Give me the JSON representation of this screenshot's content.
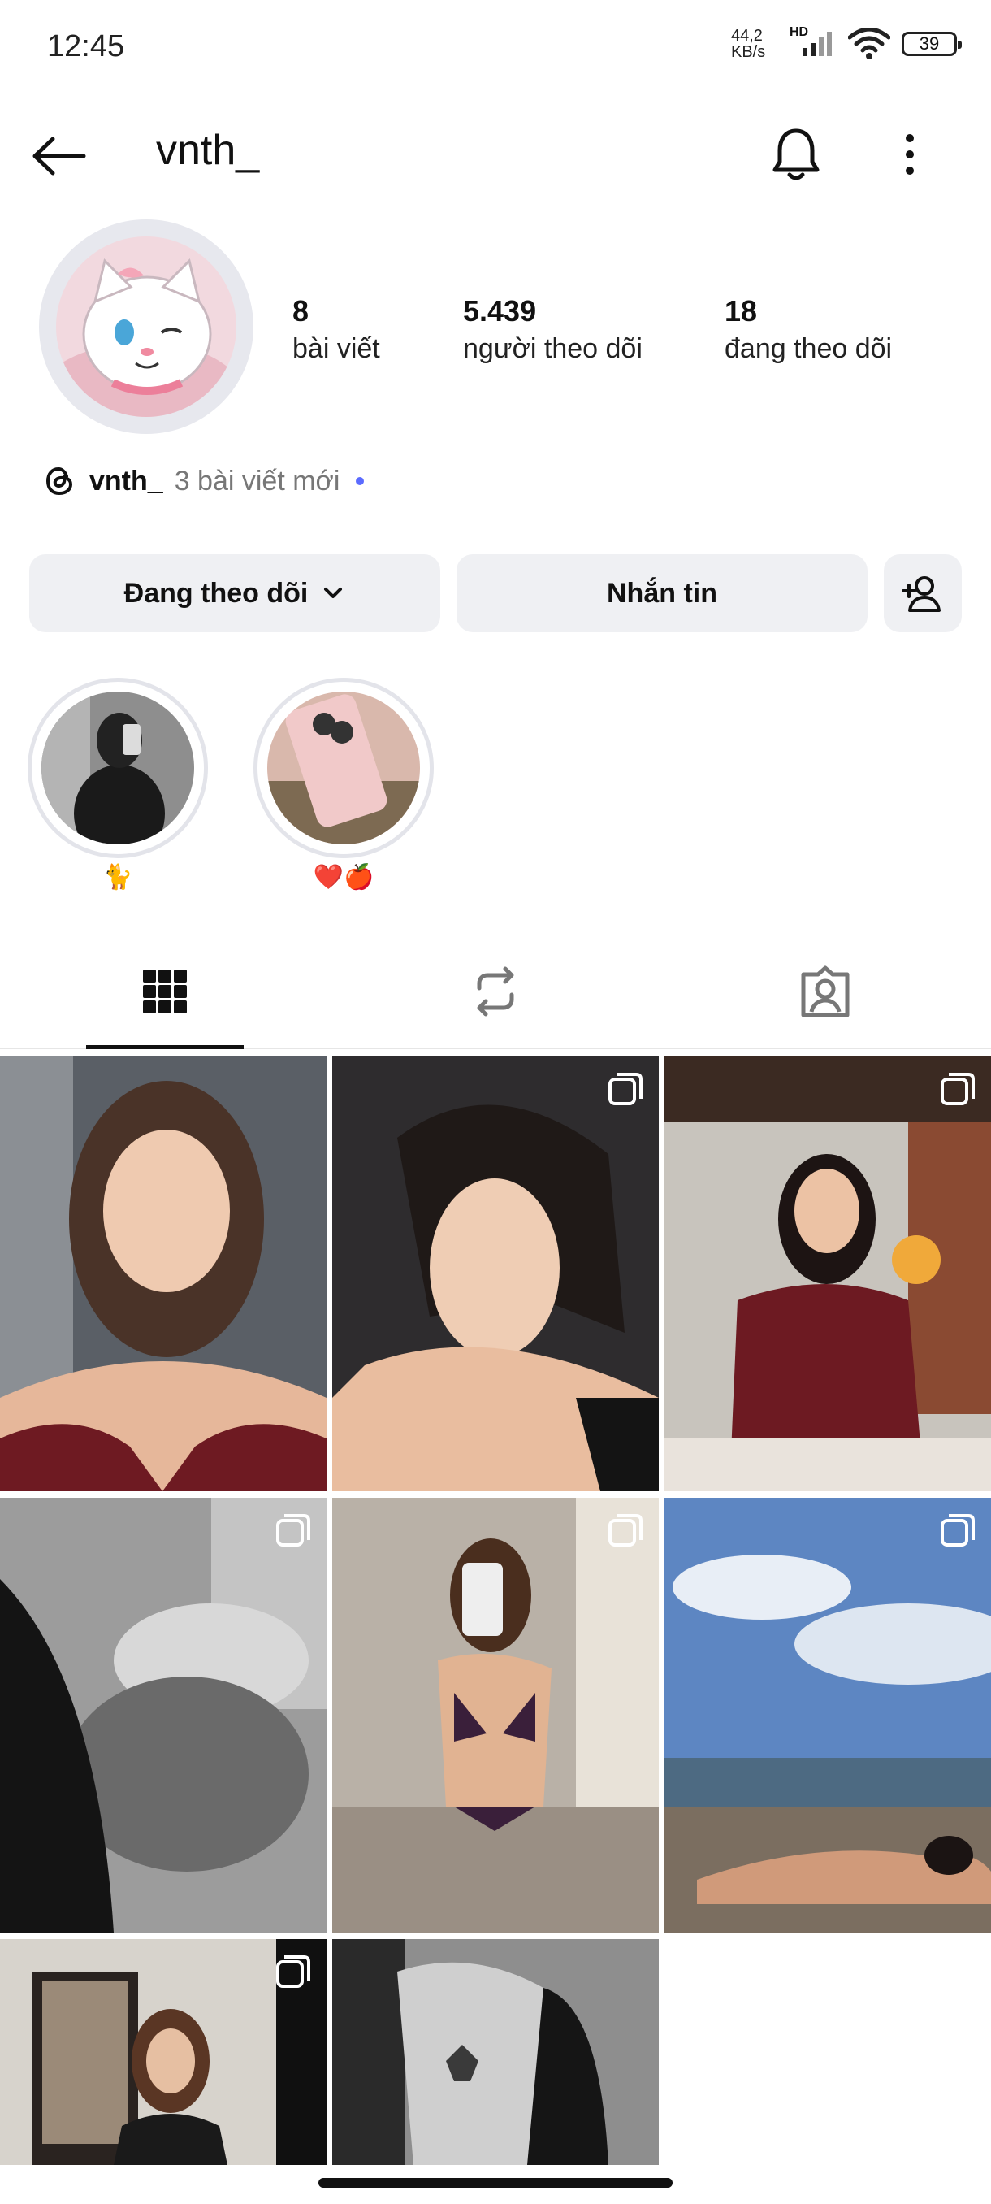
{
  "status_bar": {
    "time": "12:45",
    "net_speed_top": "44,2",
    "net_speed_bottom": "KB/s",
    "signal_badge": "HD",
    "battery": "39",
    "icons": [
      "signal-icon",
      "wifi-icon",
      "battery-icon"
    ]
  },
  "header": {
    "username": "vnth_",
    "icons": [
      "back-arrow-icon",
      "bell-icon",
      "more-vertical-icon"
    ]
  },
  "profile": {
    "stats": [
      {
        "number": "8",
        "label": "bài viết"
      },
      {
        "number": "5.439",
        "label": "người theo dõi"
      },
      {
        "number": "18",
        "label": "đang theo dõi"
      }
    ],
    "threads": {
      "name": "vnth_",
      "note": "3 bài viết mới",
      "icon": "threads-icon"
    }
  },
  "actions": {
    "following": "Đang theo dõi",
    "message": "Nhắn tin",
    "icons": [
      "chevron-down-icon",
      "add-person-icon"
    ]
  },
  "highlights": [
    {
      "label": "🐈"
    },
    {
      "label": "❤️🍎"
    }
  ],
  "tabs": {
    "icons": [
      "grid-icon",
      "reels-repost-icon",
      "tagged-icon"
    ],
    "active": "grid"
  },
  "colors": {
    "button_bg": "#eff0f3",
    "accent_dot": "#5b6bff",
    "text": "#111111"
  }
}
